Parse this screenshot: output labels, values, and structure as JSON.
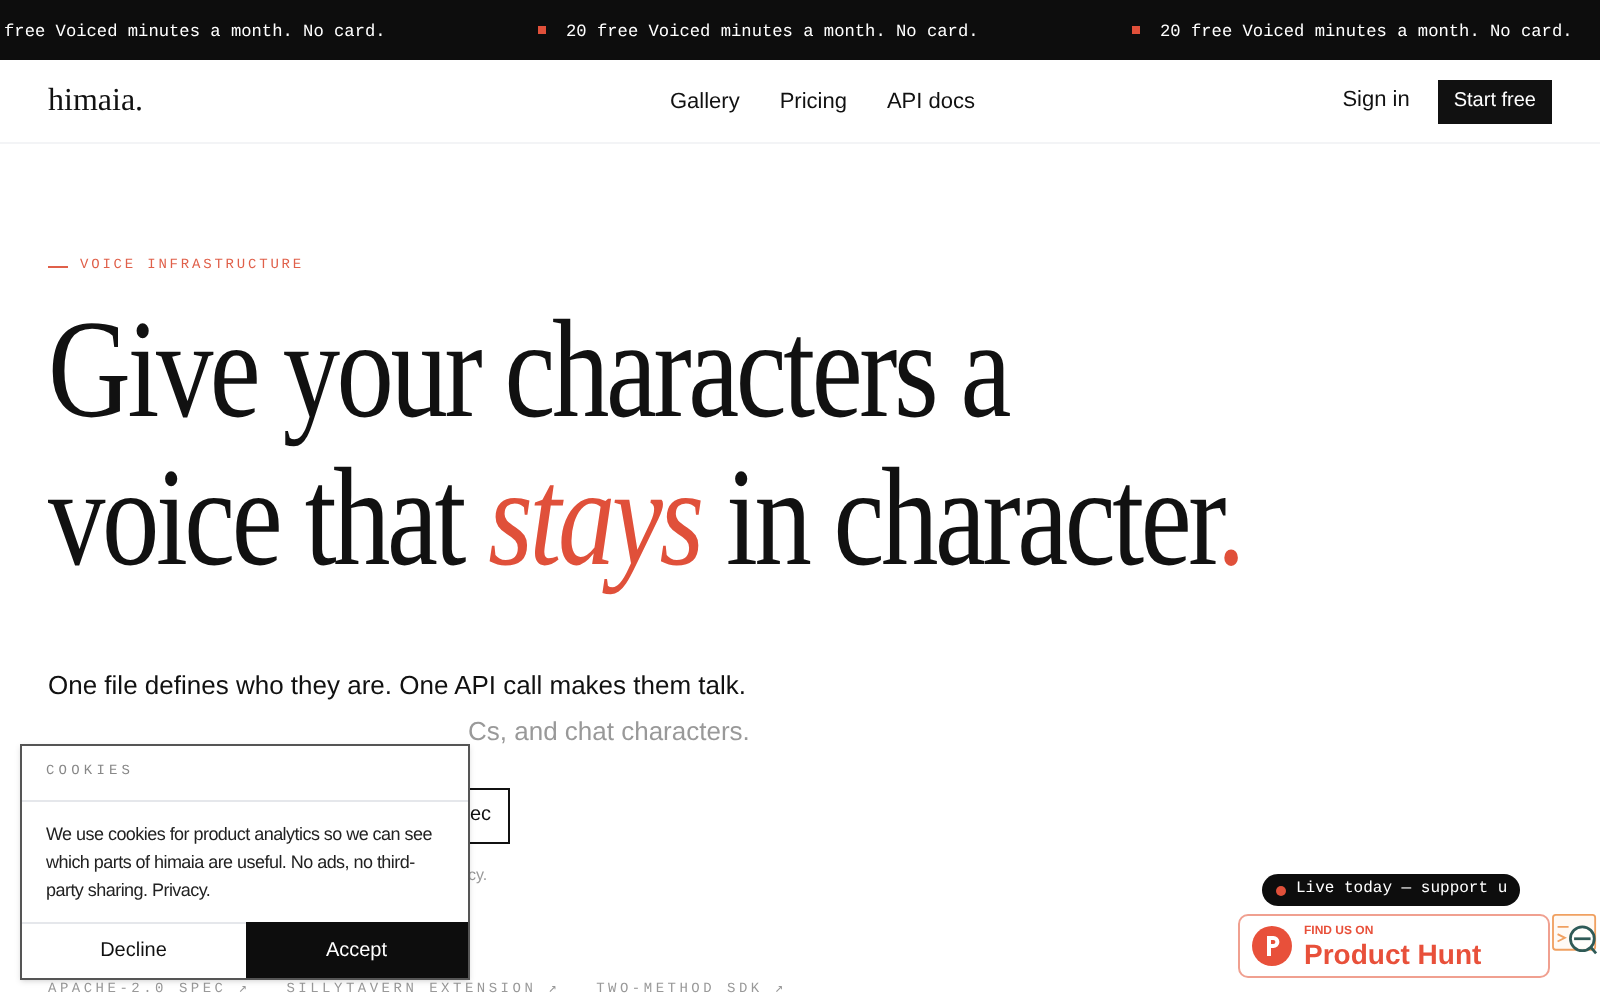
{
  "announcement_bar": {
    "items": [
      "free Voiced minutes a month. No card.",
      "20 free Voiced minutes a month. No card.",
      "20 free Voiced minutes a month. No card."
    ]
  },
  "nav": {
    "logo": "himaia.",
    "links": [
      "Gallery",
      "Pricing",
      "API docs"
    ],
    "sign_in": "Sign in",
    "cta": "Start free"
  },
  "hero": {
    "eyebrow": "VOICE INFRASTRUCTURE",
    "headline_line_1": "Give your characters a",
    "headline_line_2": "voice that *stays* in character.",
    "subtitle_line_1": "One file defines who they are. One API call makes them talk.",
    "subtitle_line_2": "Cs, and chat characters.",
    "secondary_button": "ec",
    "note": "cy.",
    "tags": [
      "APACHE-2.0 SPEC ↗",
      "SILLYTAVERN EXTENSION ↗",
      "TWO-METHOD SDK ↗"
    ]
  },
  "cookie_banner": {
    "title": "COOKIES",
    "text": "We use cookies for product analytics so we can see which parts of himaia are useful. No ads, no third-party sharing. Privacy.",
    "buttons": [
      {
        "label": "Decline",
        "kind": "secondary"
      },
      {
        "label": "Accept",
        "kind": "primary"
      }
    ]
  },
  "product_hunt": {
    "pill": "Live today — support u",
    "badge_caption": "FIND US ON",
    "badge_title": "Product Hunt"
  }
}
